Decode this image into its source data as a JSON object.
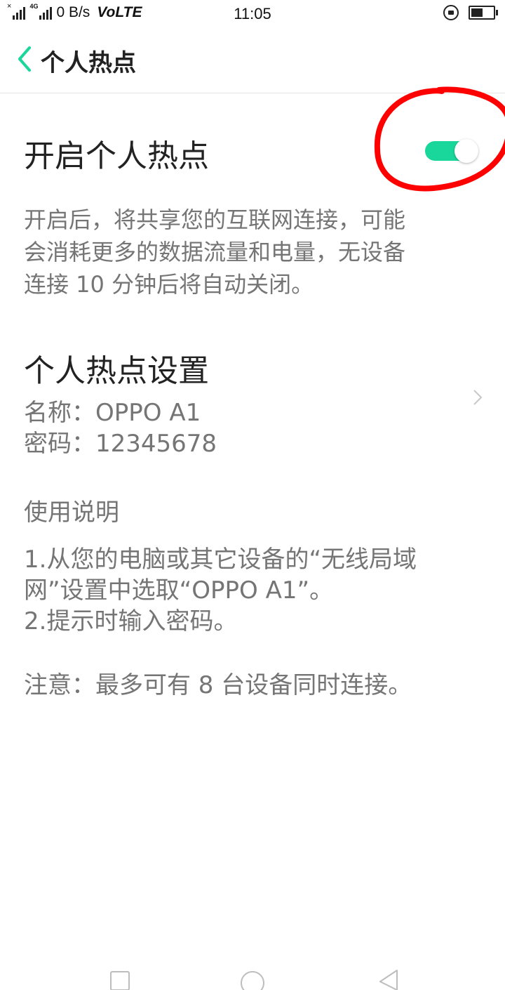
{
  "status_bar": {
    "x_mark": "×",
    "network_type": "4G",
    "speed": "0 B/s",
    "volte": "VoLTE",
    "time": "11:05",
    "battery_level": 0.6
  },
  "header": {
    "title": "个人热点"
  },
  "hotspot_toggle": {
    "label": "开启个人热点",
    "on": true,
    "accent_color": "#19d69a",
    "description_lines": [
      "开启后，将共享您的互联网连接，可能",
      "会消耗更多的数据流量和电量，无设备",
      "连接 10 分钟后将自动关闭。"
    ]
  },
  "annotation": {
    "color": "#ff0000",
    "shape": "hand-drawn circle around toggle"
  },
  "settings": {
    "title": "个人热点设置",
    "name_line": "名称：OPPO A1",
    "password_line": "密码：12345678"
  },
  "instructions": {
    "heading": "使用说明",
    "step1_line1": "1.从您的电脑或其它设备的“无线局域",
    "step1_line2": "网”设置中选取“OPPO A1”。",
    "step2": "2.提示时输入密码。",
    "note": "注意：最多可有 8 台设备同时连接。"
  },
  "nav_bar": {
    "icons": [
      "recent-apps-icon",
      "home-icon",
      "back-icon"
    ]
  }
}
